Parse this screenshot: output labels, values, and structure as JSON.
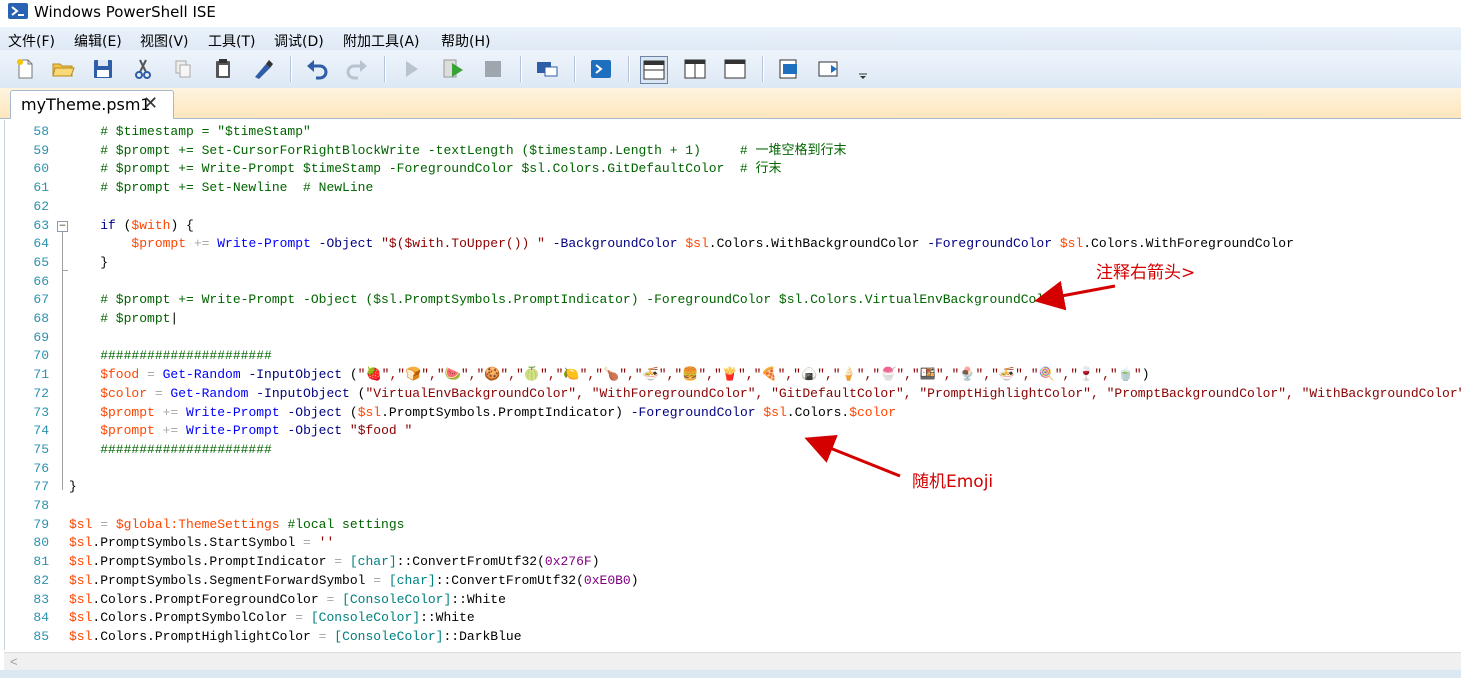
{
  "window": {
    "title": "Windows PowerShell ISE"
  },
  "menu": [
    "文件(F)",
    "编辑(E)",
    "视图(V)",
    "工具(T)",
    "调试(D)",
    "附加工具(A)",
    "帮助(H)"
  ],
  "toolbar": {
    "icons": [
      "new-file-icon",
      "open-folder-icon",
      "save-icon",
      "cut-icon",
      "copy-icon",
      "paste-icon",
      "clear-console-icon",
      "undo-icon",
      "redo-icon",
      "run-icon",
      "run-selection-icon",
      "stop-icon",
      "remote-powershell-icon",
      "powershell-console-icon",
      "show-script-top-icon",
      "show-script-right-icon",
      "show-script-maximized-icon",
      "show-command-window-icon",
      "show-addon-icon",
      "more-icon"
    ]
  },
  "tab": {
    "name": "myTheme.psm1",
    "close": "✕"
  },
  "lines": [
    {
      "n": "58",
      "segs": [
        [
          "c-com",
          "    # $timestamp = \"$timeStamp\""
        ]
      ]
    },
    {
      "n": "59",
      "segs": [
        [
          "c-com",
          "    # $prompt += Set-CursorForRightBlockWrite -textLength ($timestamp.Length + 1)     # 一堆空格到行末"
        ]
      ]
    },
    {
      "n": "60",
      "segs": [
        [
          "c-com",
          "    # $prompt += Write-Prompt $timeStamp -ForegroundColor $sl.Colors.GitDefaultColor  # 行末"
        ]
      ]
    },
    {
      "n": "61",
      "segs": [
        [
          "c-com",
          "    # $prompt += Set-Newline  # NewLine"
        ]
      ]
    },
    {
      "n": "62",
      "segs": []
    },
    {
      "n": "63",
      "segs": [
        [
          "c-kw",
          "    if "
        ],
        [
          "c-mem",
          "("
        ],
        [
          "c-var",
          "$with"
        ],
        [
          "c-mem",
          ") {"
        ]
      ]
    },
    {
      "n": "64",
      "segs": [
        [
          "c-var",
          "        $prompt"
        ],
        [
          "c-op",
          " += "
        ],
        [
          "c-cmd",
          "Write-Prompt"
        ],
        [
          "c-par",
          " -Object "
        ],
        [
          "c-str",
          "\"$($with.ToUpper()) \""
        ],
        [
          "c-par",
          " -BackgroundColor "
        ],
        [
          "c-var",
          "$sl"
        ],
        [
          "c-mem",
          ".Colors.WithBackgroundColor "
        ],
        [
          "c-par",
          "-ForegroundColor "
        ],
        [
          "c-var",
          "$sl"
        ],
        [
          "c-mem",
          ".Colors.WithForegroundColor"
        ]
      ]
    },
    {
      "n": "65",
      "segs": [
        [
          "c-mem",
          "    }"
        ]
      ]
    },
    {
      "n": "66",
      "segs": []
    },
    {
      "n": "67",
      "segs": [
        [
          "c-com",
          "    # $prompt += Write-Prompt -Object ($sl.PromptSymbols.PromptIndicator) -ForegroundColor $sl.Colors.VirtualEnvBackgroundColor"
        ]
      ]
    },
    {
      "n": "68",
      "segs": [
        [
          "c-com",
          "    # $prompt"
        ],
        [
          "c-mem",
          "|"
        ]
      ]
    },
    {
      "n": "69",
      "segs": []
    },
    {
      "n": "70",
      "segs": [
        [
          "c-com",
          "    ######################"
        ]
      ]
    },
    {
      "n": "71",
      "segs": [
        [
          "c-var",
          "    $food"
        ],
        [
          "c-op",
          " = "
        ],
        [
          "c-cmd",
          "Get-Random"
        ],
        [
          "c-par",
          " -InputObject "
        ],
        [
          "c-mem",
          "("
        ],
        [
          "c-str",
          "\"🍓\",\"🍞\",\"🍉\",\"🍪\",\"🍈\",\"🍋\",\"🍗\",\"🍜\",\"🍔\",\"🍟\",\"🍕\",\"🍙\",\"🍦\",\"🍧\",\"🍱\",\"🍨\",\"🍜\",\"🍭\",\"🍷\",\"🍵\""
        ],
        [
          "c-mem",
          ")"
        ]
      ]
    },
    {
      "n": "72",
      "segs": [
        [
          "c-var",
          "    $color"
        ],
        [
          "c-op",
          " = "
        ],
        [
          "c-cmd",
          "Get-Random"
        ],
        [
          "c-par",
          " -InputObject "
        ],
        [
          "c-mem",
          "("
        ],
        [
          "c-str",
          "\"VirtualEnvBackgroundColor\", \"WithForegroundColor\", \"GitDefaultColor\", \"PromptHighlightColor\", \"PromptBackgroundColor\", \"WithBackgroundColor\""
        ],
        [
          "c-mem",
          ")"
        ]
      ]
    },
    {
      "n": "73",
      "segs": [
        [
          "c-var",
          "    $prompt"
        ],
        [
          "c-op",
          " += "
        ],
        [
          "c-cmd",
          "Write-Prompt"
        ],
        [
          "c-par",
          " -Object "
        ],
        [
          "c-mem",
          "("
        ],
        [
          "c-var",
          "$sl"
        ],
        [
          "c-mem",
          ".PromptSymbols.PromptIndicator) "
        ],
        [
          "c-par",
          "-ForegroundColor "
        ],
        [
          "c-var",
          "$sl"
        ],
        [
          "c-mem",
          ".Colors."
        ],
        [
          "c-var",
          "$color"
        ]
      ]
    },
    {
      "n": "74",
      "segs": [
        [
          "c-var",
          "    $prompt"
        ],
        [
          "c-op",
          " += "
        ],
        [
          "c-cmd",
          "Write-Prompt"
        ],
        [
          "c-par",
          " -Object "
        ],
        [
          "c-str",
          "\"$food \""
        ]
      ]
    },
    {
      "n": "75",
      "segs": [
        [
          "c-com",
          "    ######################"
        ]
      ]
    },
    {
      "n": "76",
      "segs": []
    },
    {
      "n": "77",
      "segs": [
        [
          "c-mem",
          "}"
        ]
      ]
    },
    {
      "n": "78",
      "segs": []
    },
    {
      "n": "79",
      "segs": [
        [
          "c-var",
          "$sl"
        ],
        [
          "c-op",
          " = "
        ],
        [
          "c-var",
          "$global:ThemeSettings"
        ],
        [
          "c-com",
          " #local settings"
        ]
      ]
    },
    {
      "n": "80",
      "segs": [
        [
          "c-var",
          "$sl"
        ],
        [
          "c-mem",
          ".PromptSymbols.StartSymbol "
        ],
        [
          "c-op",
          "= "
        ],
        [
          "c-str",
          "''"
        ]
      ]
    },
    {
      "n": "81",
      "segs": [
        [
          "c-var",
          "$sl"
        ],
        [
          "c-mem",
          ".PromptSymbols.PromptIndicator "
        ],
        [
          "c-op",
          "= "
        ],
        [
          "c-typ",
          "[char]"
        ],
        [
          "c-mem",
          "::ConvertFromUtf32("
        ],
        [
          "c-num",
          "0x276F"
        ],
        [
          "c-mem",
          ")"
        ]
      ]
    },
    {
      "n": "82",
      "segs": [
        [
          "c-var",
          "$sl"
        ],
        [
          "c-mem",
          ".PromptSymbols.SegmentForwardSymbol "
        ],
        [
          "c-op",
          "= "
        ],
        [
          "c-typ",
          "[char]"
        ],
        [
          "c-mem",
          "::ConvertFromUtf32("
        ],
        [
          "c-num",
          "0xE0B0"
        ],
        [
          "c-mem",
          ")"
        ]
      ]
    },
    {
      "n": "83",
      "segs": [
        [
          "c-var",
          "$sl"
        ],
        [
          "c-mem",
          ".Colors.PromptForegroundColor "
        ],
        [
          "c-op",
          "= "
        ],
        [
          "c-typ",
          "[ConsoleColor]"
        ],
        [
          "c-mem",
          "::White"
        ]
      ]
    },
    {
      "n": "84",
      "segs": [
        [
          "c-var",
          "$sl"
        ],
        [
          "c-mem",
          ".Colors.PromptSymbolColor "
        ],
        [
          "c-op",
          "= "
        ],
        [
          "c-typ",
          "[ConsoleColor]"
        ],
        [
          "c-mem",
          "::White"
        ]
      ]
    },
    {
      "n": "85",
      "segs": [
        [
          "c-var",
          "$sl"
        ],
        [
          "c-mem",
          ".Colors.PromptHighlightColor "
        ],
        [
          "c-op",
          "= "
        ],
        [
          "c-typ",
          "[ConsoleColor]"
        ],
        [
          "c-mem",
          "::DarkBlue"
        ]
      ]
    }
  ],
  "annotations": {
    "arrow_comment": "注释右箭头>",
    "arrow_emoji": "随机Emoji"
  },
  "colors": {
    "annotation": "#d40000",
    "line_numbers": "#2b91af"
  }
}
